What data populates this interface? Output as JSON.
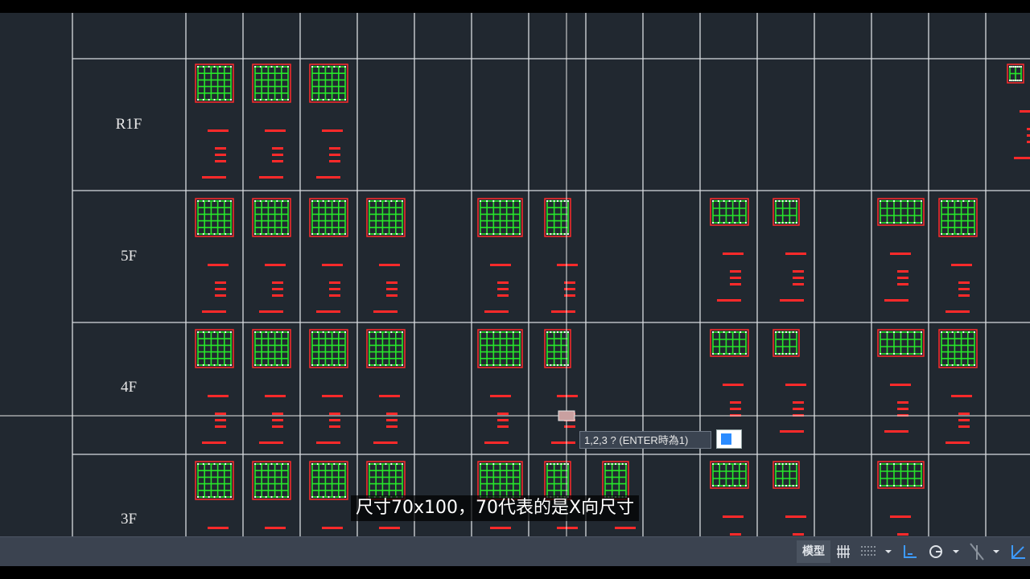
{
  "floors": [
    {
      "label": "R1F",
      "row": 0
    },
    {
      "label": "5F",
      "row": 1
    },
    {
      "label": "4F",
      "row": 2
    },
    {
      "label": "3F",
      "row": 3
    }
  ],
  "command_prompt": {
    "text": "1,2,3 ? (ENTER時為1)",
    "input_value": ""
  },
  "subtitle": "尺寸70x100，70代表的是X向尺寸",
  "statusbar": {
    "model_tab": "模型",
    "icons": [
      "grid-display-icon",
      "snap-mode-icon",
      "dropdown-icon",
      "ortho-mode-icon",
      "polar-tracking-icon",
      "dropdown-icon",
      "object-snap-icon",
      "dropdown-icon",
      "dynamic-ucs-icon"
    ]
  },
  "colors": {
    "background": "#212830",
    "grid_lines": "#d8dce0",
    "column_outline": "#ff2a2a",
    "rebar": "#27e62a",
    "annotation": "#ff2a2a",
    "crosshair": "#e6e6e6"
  }
}
